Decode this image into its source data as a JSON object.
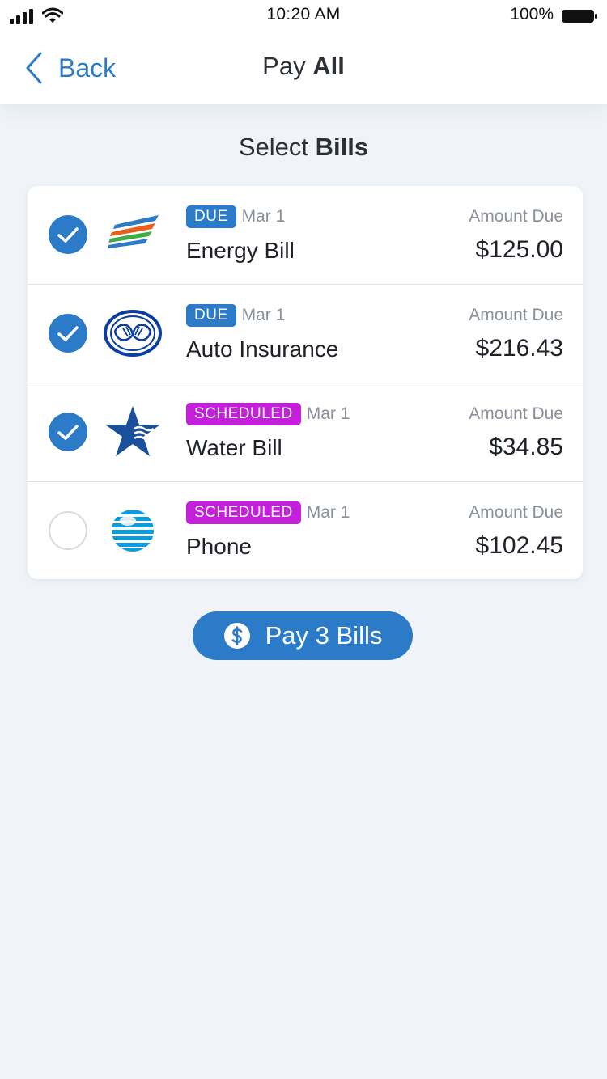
{
  "status_bar": {
    "time": "10:20 AM",
    "battery": "100%"
  },
  "nav": {
    "back_label": "Back",
    "title_light": "Pay ",
    "title_bold": "All"
  },
  "section": {
    "title_light": "Select ",
    "title_bold": "Bills"
  },
  "bills": [
    {
      "selected": true,
      "logo": "energy-logo",
      "status": "DUE",
      "status_color": "#2b7bc9",
      "date": "Mar 1",
      "name": "Energy Bill",
      "amount_label": "Amount Due",
      "amount": "$125.00"
    },
    {
      "selected": true,
      "logo": "allstate-hands-logo",
      "status": "DUE",
      "status_color": "#2b7bc9",
      "date": "Mar 1",
      "name": "Auto Insurance",
      "amount_label": "Amount Due",
      "amount": "$216.43"
    },
    {
      "selected": true,
      "logo": "water-star-logo",
      "status": "SCHEDULED",
      "status_color": "#c41fdb",
      "date": "Mar 1",
      "name": "Water Bill",
      "amount_label": "Amount Due",
      "amount": "$34.85"
    },
    {
      "selected": false,
      "logo": "att-globe-logo",
      "status": "SCHEDULED",
      "status_color": "#c41fdb",
      "date": "Mar 1",
      "name": "Phone",
      "amount_label": "Amount Due",
      "amount": "$102.45"
    }
  ],
  "pay_button": {
    "icon": "dollar-circle-icon",
    "label": "Pay 3 Bills"
  },
  "colors": {
    "accent": "#2b7bc9",
    "scheduled": "#c41fdb",
    "background": "#f0f4f8"
  }
}
